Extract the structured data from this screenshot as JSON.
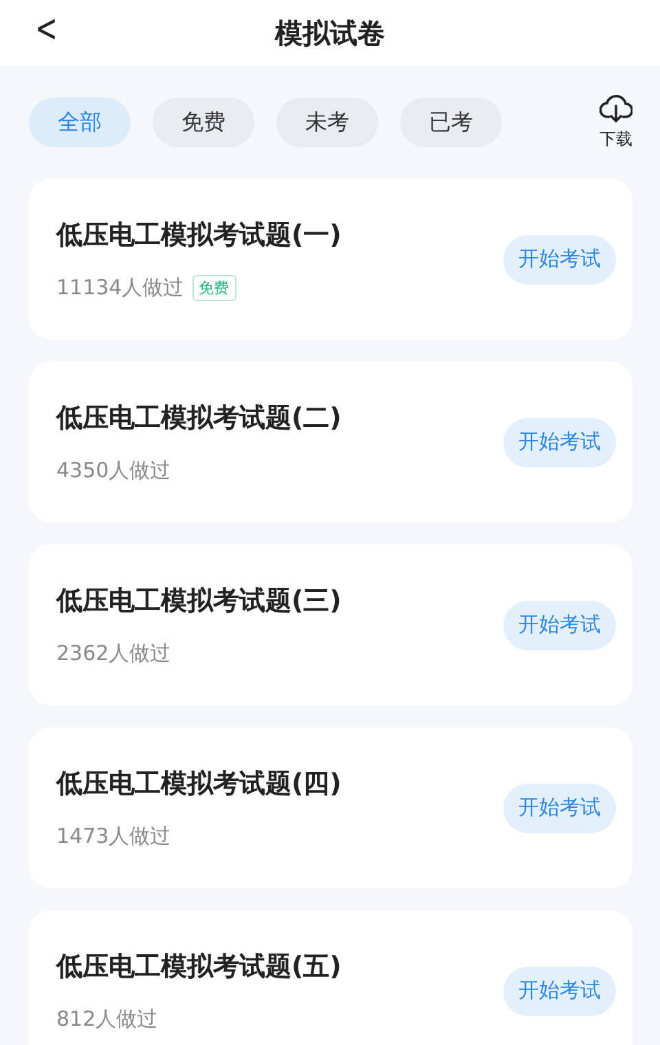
{
  "header": {
    "back": "<",
    "title": "模拟试卷"
  },
  "filters": [
    {
      "label": "全部",
      "selected": true
    },
    {
      "label": "免费",
      "selected": false
    },
    {
      "label": "未考",
      "selected": false
    },
    {
      "label": "已考",
      "selected": false
    }
  ],
  "download": {
    "label": "下载"
  },
  "papers": [
    {
      "title": "低压电工模拟考试题(一)",
      "count": "11134人做过",
      "tag": "免费",
      "button": "开始考试"
    },
    {
      "title": "低压电工模拟考试题(二)",
      "count": "4350人做过",
      "button": "开始考试"
    },
    {
      "title": "低压电工模拟考试题(三)",
      "count": "2362人做过",
      "button": "开始考试"
    },
    {
      "title": "低压电工模拟考试题(四)",
      "count": "1473人做过",
      "button": "开始考试"
    },
    {
      "title": "低压电工模拟考试题(五)",
      "count": "812人做过",
      "button": "开始考试"
    }
  ]
}
